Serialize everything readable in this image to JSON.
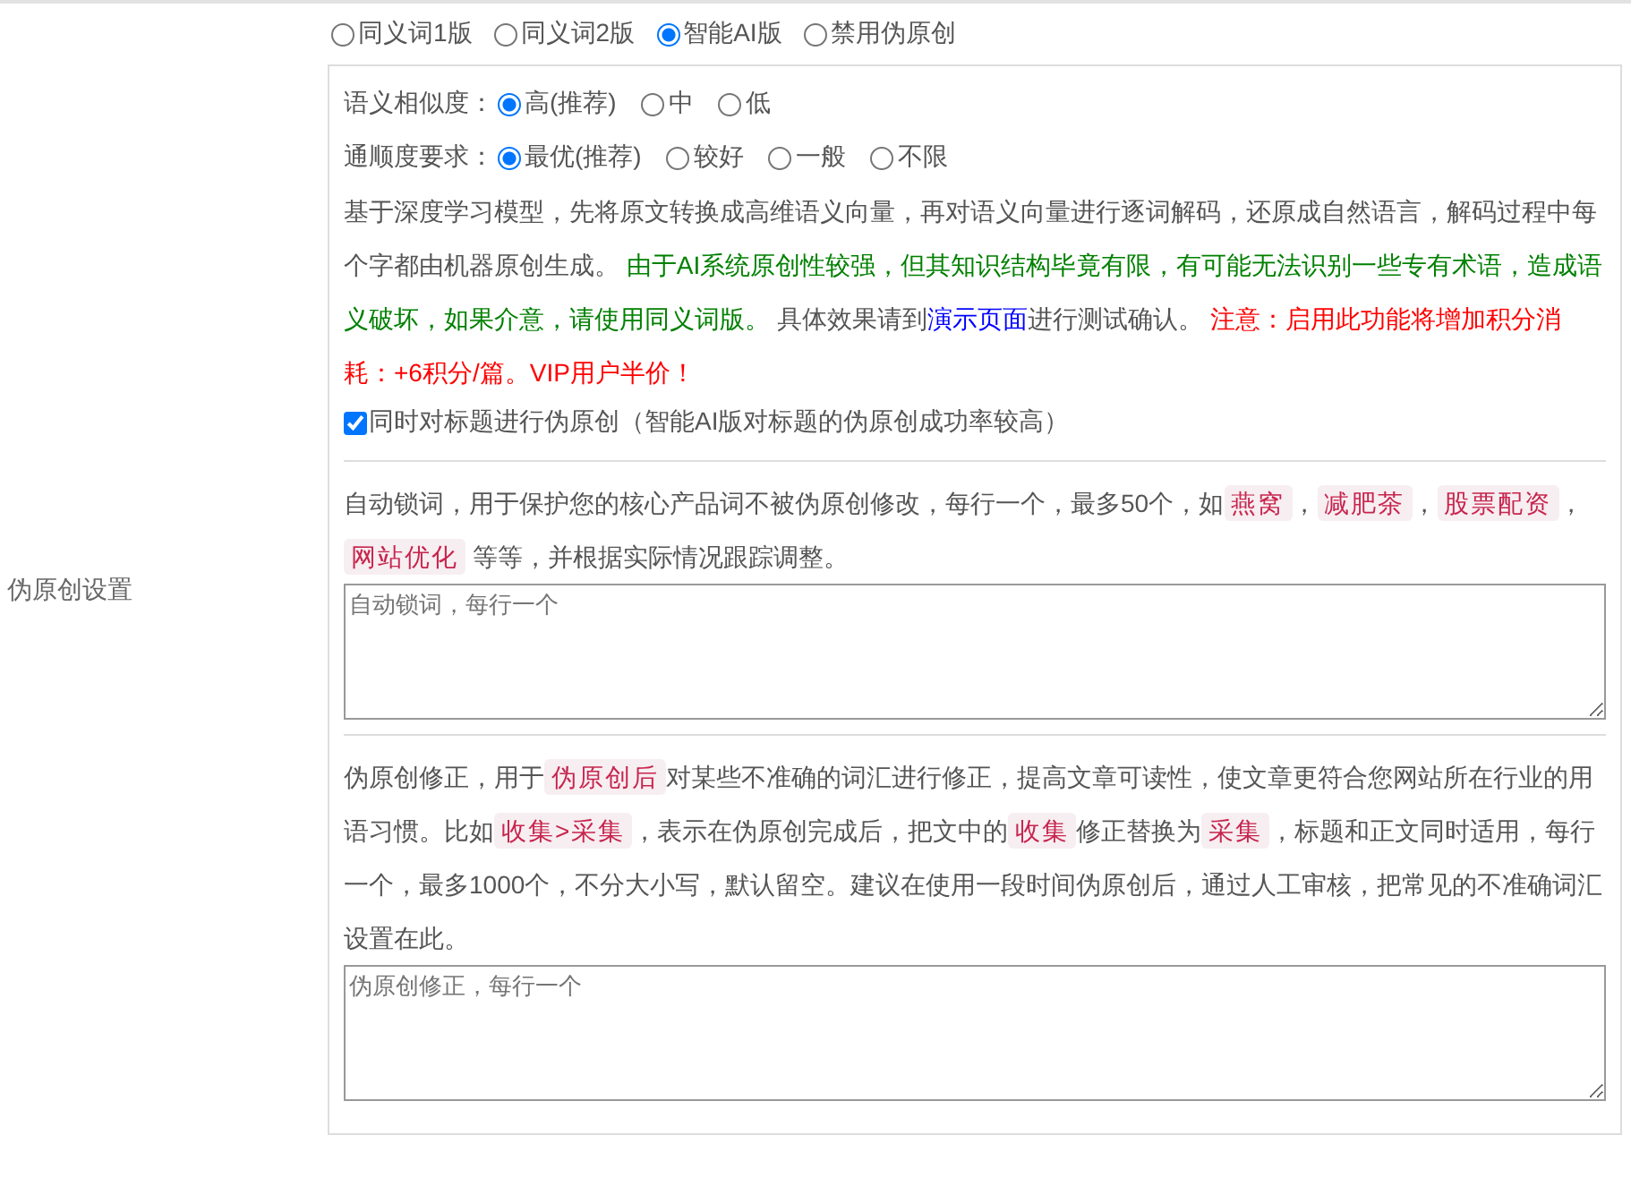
{
  "section_label": "伪原创设置",
  "mode_options": [
    {
      "label": "同义词1版",
      "selected": false
    },
    {
      "label": "同义词2版",
      "selected": false
    },
    {
      "label": "智能AI版",
      "selected": true
    },
    {
      "label": "禁用伪原创",
      "selected": false
    }
  ],
  "settings": [
    {
      "label": "语义相似度：",
      "options": [
        {
          "label": "高(推荐)",
          "selected": true
        },
        {
          "label": "中",
          "selected": false
        },
        {
          "label": "低",
          "selected": false
        }
      ]
    },
    {
      "label": "通顺度要求：",
      "options": [
        {
          "label": "最优(推荐)",
          "selected": true
        },
        {
          "label": "较好",
          "selected": false
        },
        {
          "label": "一般",
          "selected": false
        },
        {
          "label": "不限",
          "selected": false
        }
      ]
    }
  ],
  "description": [
    {
      "kind": "plain",
      "text": "基于深度学习模型，先将原文转换成高维语义向量，再对语义向量进行逐词解码，还原成自然语言，解码过程中每个字都由机器原创生成。 "
    },
    {
      "kind": "warning",
      "text": "由于AI系统原创性较强，但其知识结构毕竟有限，有可能无法识别一些专有术语，造成语义破坏，如果介意，请使用同义词版。"
    },
    {
      "kind": "plain",
      "text": " 具体效果请到"
    },
    {
      "kind": "link",
      "text": "演示页面"
    },
    {
      "kind": "plain",
      "text": "进行测试确认。 "
    },
    {
      "kind": "notice",
      "text": "注意：启用此功能将增加积分消耗：+6积分/篇。VIP用户半价！"
    }
  ],
  "title_option": {
    "label": "同时对标题进行伪原创（智能AI版对标题的伪原创成功率较高）",
    "checked": true
  },
  "lock_words": {
    "description": [
      {
        "kind": "plain",
        "text": "自动锁词，用于保护您的核心产品词不被伪原创修改，每行一个，最多50个，如"
      },
      {
        "kind": "code",
        "text": "燕窝"
      },
      {
        "kind": "plain",
        "text": "，"
      },
      {
        "kind": "code",
        "text": "减肥茶"
      },
      {
        "kind": "plain",
        "text": "，"
      },
      {
        "kind": "code",
        "text": "股票配资"
      },
      {
        "kind": "plain",
        "text": "，"
      },
      {
        "kind": "code",
        "text": "网站优化"
      },
      {
        "kind": "plain",
        "text": " 等等，并根据实际情况跟踪调整。"
      }
    ],
    "placeholder": "自动锁词，每行一个"
  },
  "correction": {
    "description": [
      {
        "kind": "plain",
        "text": "伪原创修正，用于"
      },
      {
        "kind": "code",
        "text": "伪原创后"
      },
      {
        "kind": "plain",
        "text": "对某些不准确的词汇进行修正，提高文章可读性，使文章更符合您网站所在行业的用语习惯。比如"
      },
      {
        "kind": "code",
        "text": "收集>采集"
      },
      {
        "kind": "plain",
        "text": "，表示在伪原创完成后，把文中的"
      },
      {
        "kind": "code",
        "text": "收集"
      },
      {
        "kind": "plain",
        "text": "修正替换为"
      },
      {
        "kind": "code",
        "text": "采集"
      },
      {
        "kind": "plain",
        "text": "，标题和正文同时适用，每行一个，最多1000个，不分大小写，默认留空。建议在使用一段时间伪原创后，通过人工审核，把常见的不准确词汇设置在此。"
      }
    ],
    "placeholder": "伪原创修正，每行一个"
  }
}
